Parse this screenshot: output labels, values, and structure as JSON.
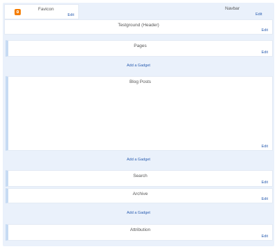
{
  "header_row": {
    "favicon": {
      "title": "Favicon",
      "edit": "Edit"
    },
    "navbar": {
      "title": "Navbar",
      "edit": "Edit"
    }
  },
  "sections": {
    "header": {
      "title": "Testground (Header)",
      "edit": "Edit"
    },
    "pages": {
      "title": "Pages",
      "edit": "Edit"
    },
    "blog_posts": {
      "title": "Blog Posts",
      "edit": "Edit"
    },
    "search": {
      "title": "Search",
      "edit": "Edit"
    },
    "archive": {
      "title": "Archive",
      "edit": "Edit"
    },
    "attribution": {
      "title": "Attribution",
      "edit": "Edit"
    }
  },
  "add_gadget": {
    "label_1": "Add a Gadget",
    "label_2": "Add a Gadget",
    "label_3": "Add a Gadget"
  },
  "colors": {
    "accent": "#2a5db0",
    "background": "#eaf1fb",
    "bar": "#c7dbf3",
    "favicon": "#f57d00"
  }
}
